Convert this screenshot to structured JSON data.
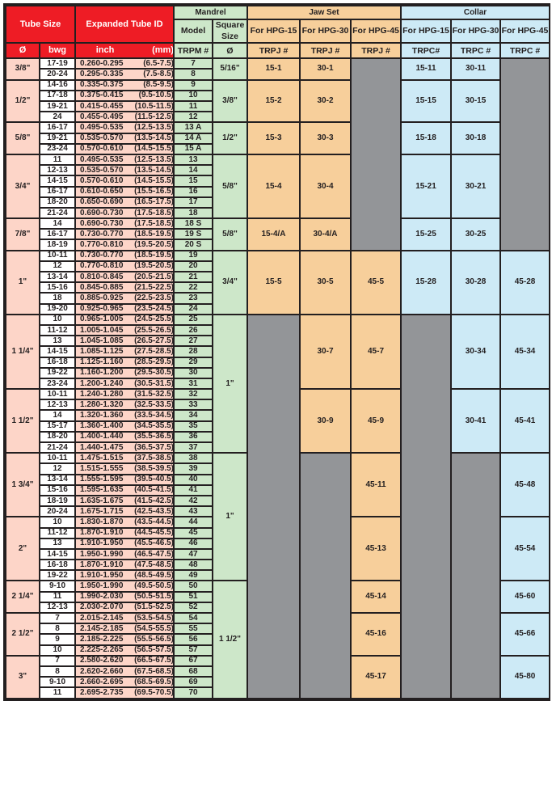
{
  "header": {
    "tube_size": "Tube Size",
    "expanded_id": "Expanded Tube ID",
    "mandrel": "Mandrel",
    "jaw_set": "Jaw Set",
    "collar": "Collar",
    "model": "Model",
    "square_size": "Square Size",
    "hpg15": "For HPG-15",
    "hpg30": "For HPG-30",
    "hpg45": "For HPG-45",
    "dia": "Ø",
    "bwg": "bwg",
    "inch": "inch",
    "mm": "(mm)",
    "trpm": "TRPM #",
    "sq_dia": "Ø",
    "trpj": "TRPJ #",
    "trpc1": "TRPC#",
    "trpc": "TRPC #"
  },
  "colors": {
    "red": "#ee1c25",
    "pink": "#fdd5c8",
    "green": "#cde7c9",
    "orange": "#f7cf9b",
    "blue": "#cdeaf6",
    "gray": "#939598"
  },
  "table": {
    "square_sizes": [
      {
        "size": "5/16\"",
        "rows": 2
      },
      {
        "size": "3/8\"",
        "rows": 4
      },
      {
        "size": "1/2\"",
        "rows": 3
      },
      {
        "size": "5/8\"",
        "rows": 6
      },
      {
        "size": "5/8\"",
        "rows": 3
      },
      {
        "size": "3/4\"",
        "rows": 6
      },
      {
        "size": "1\"",
        "rows": 13
      },
      {
        "size": "1\"",
        "rows": 12
      },
      {
        "size": "1 1/2\"",
        "rows": 11
      }
    ],
    "groups": [
      {
        "size": "3/8\"",
        "rows": [
          [
            "17-19",
            "0.260-0.295",
            "(6.5-7.5)",
            "7"
          ],
          [
            "20-24",
            "0.295-0.335",
            "(7.5-8.5)",
            "8"
          ]
        ],
        "jaw_hpg15": "15-1",
        "jaw_hpg30": "30-1",
        "jaw_hpg45": null,
        "collar_hpg15": "15-11",
        "collar_hpg30": "30-11",
        "collar_hpg45": null
      },
      {
        "size": "1/2\"",
        "rows": [
          [
            "14-16",
            "0.335-0.375",
            "(8.5-9.5)",
            "9"
          ],
          [
            "17-18",
            "0.375-0.415",
            "(9.5-10.5)",
            "10"
          ],
          [
            "19-21",
            "0.415-0.455",
            "(10.5-11.5)",
            "11"
          ],
          [
            "24",
            "0.455-0.495",
            "(11.5-12.5)",
            "12"
          ]
        ],
        "jaw_hpg15": "15-2",
        "jaw_hpg30": "30-2",
        "jaw_hpg45": null,
        "collar_hpg15": "15-15",
        "collar_hpg30": "30-15",
        "collar_hpg45": null
      },
      {
        "size": "5/8\"",
        "rows": [
          [
            "16-17",
            "0.495-0.535",
            "(12.5-13.5)",
            "13 A"
          ],
          [
            "19-21",
            "0.535-0.570",
            "(13.5-14.5)",
            "14 A"
          ],
          [
            "23-24",
            "0.570-0.610",
            "(14.5-15.5)",
            "15 A"
          ]
        ],
        "jaw_hpg15": "15-3",
        "jaw_hpg30": "30-3",
        "jaw_hpg45": null,
        "collar_hpg15": "15-18",
        "collar_hpg30": "30-18",
        "collar_hpg45": null
      },
      {
        "size": "3/4\"",
        "rows": [
          [
            "11",
            "0.495-0.535",
            "(12.5-13.5)",
            "13"
          ],
          [
            "12-13",
            "0.535-0.570",
            "(13.5-14.5)",
            "14"
          ],
          [
            "14-15",
            "0.570-0.610",
            "(14.5-15.5)",
            "15"
          ],
          [
            "16-17",
            "0.610-0.650",
            "(15.5-16.5)",
            "16"
          ],
          [
            "18-20",
            "0.650-0.690",
            "(16.5-17.5)",
            "17"
          ],
          [
            "21-24",
            "0.690-0.730",
            "(17.5-18.5)",
            "18"
          ]
        ],
        "jaw_hpg15": "15-4",
        "jaw_hpg30": "30-4",
        "jaw_hpg45": null,
        "collar_hpg15": "15-21",
        "collar_hpg30": "30-21",
        "collar_hpg45": null
      },
      {
        "size": "7/8\"",
        "rows": [
          [
            "14",
            "0.690-0.730",
            "(17.5-18.5)",
            "18 S"
          ],
          [
            "16-17",
            "0.730-0.770",
            "(18.5-19.5)",
            "19 S"
          ],
          [
            "18-19",
            "0.770-0.810",
            "(19.5-20.5)",
            "20 S"
          ]
        ],
        "jaw_hpg15": "15-4/A",
        "jaw_hpg30": "30-4/A",
        "jaw_hpg45": null,
        "collar_hpg15": "15-25",
        "collar_hpg30": "30-25",
        "collar_hpg45": null
      },
      {
        "size": "1\"",
        "rows": [
          [
            "10-11",
            "0.730-0.770",
            "(18.5-19.5)",
            "19"
          ],
          [
            "12",
            "0.770-0.810",
            "(19.5-20.5)",
            "20"
          ],
          [
            "13-14",
            "0.810-0.845",
            "(20.5-21.5)",
            "21"
          ],
          [
            "15-16",
            "0.845-0.885",
            "(21.5-22.5)",
            "22"
          ],
          [
            "18",
            "0.885-0.925",
            "(22.5-23.5)",
            "23"
          ],
          [
            "19-20",
            "0.925-0.965",
            "(23.5-24.5)",
            "24"
          ]
        ],
        "jaw_hpg15": "15-5",
        "jaw_hpg30": "30-5",
        "jaw_hpg45": "45-5",
        "collar_hpg15": "15-28",
        "collar_hpg30": "30-28",
        "collar_hpg45": "45-28"
      },
      {
        "size": "1 1/4\"",
        "rows": [
          [
            "10",
            "0.965-1.005",
            "(24.5-25.5)",
            "25"
          ],
          [
            "11-12",
            "1.005-1.045",
            "(25.5-26.5)",
            "26"
          ],
          [
            "13",
            "1.045-1.085",
            "(26.5-27.5)",
            "27"
          ],
          [
            "14-15",
            "1.085-1.125",
            "(27.5-28.5)",
            "28"
          ],
          [
            "16-18",
            "1.125-1.160",
            "(28.5-29.5)",
            "29"
          ],
          [
            "19-22",
            "1.160-1.200",
            "(29.5-30.5)",
            "30"
          ],
          [
            "23-24",
            "1.200-1.240",
            "(30.5-31.5)",
            "31"
          ]
        ],
        "jaw_hpg15": null,
        "jaw_hpg30": "30-7",
        "jaw_hpg45": "45-7",
        "collar_hpg15": null,
        "collar_hpg30": "30-34",
        "collar_hpg45": "45-34"
      },
      {
        "size": "1 1/2\"",
        "rows": [
          [
            "10-11",
            "1.240-1.280",
            "(31.5-32.5)",
            "32"
          ],
          [
            "12-13",
            "1.280-1.320",
            "(32.5-33.5)",
            "33"
          ],
          [
            "14",
            "1.320-1.360",
            "(33.5-34.5)",
            "34"
          ],
          [
            "15-17",
            "1.360-1.400",
            "(34.5-35.5)",
            "35"
          ],
          [
            "18-20",
            "1.400-1.440",
            "(35.5-36.5)",
            "36"
          ],
          [
            "21-24",
            "1.440-1.475",
            "(36.5-37.5)",
            "37"
          ]
        ],
        "jaw_hpg15": null,
        "jaw_hpg30": "30-9",
        "jaw_hpg45": "45-9",
        "collar_hpg15": null,
        "collar_hpg30": "30-41",
        "collar_hpg45": "45-41"
      },
      {
        "size": "1 3/4\"",
        "rows": [
          [
            "10-11",
            "1.475-1.515",
            "(37.5-38.5)",
            "38"
          ],
          [
            "12",
            "1.515-1.555",
            "(38.5-39.5)",
            "39"
          ],
          [
            "13-14",
            "1.555-1.595",
            "(39.5-40.5)",
            "40"
          ],
          [
            "15-16",
            "1.595-1.635",
            "(40.5-41.5)",
            "41"
          ],
          [
            "18-19",
            "1.635-1.675",
            "(41.5-42.5)",
            "42"
          ],
          [
            "20-24",
            "1.675-1.715",
            "(42.5-43.5)",
            "43"
          ]
        ],
        "jaw_hpg15": null,
        "jaw_hpg30": null,
        "jaw_hpg45": "45-11",
        "collar_hpg15": null,
        "collar_hpg30": null,
        "collar_hpg45": "45-48"
      },
      {
        "size": "2\"",
        "rows": [
          [
            "10",
            "1.830-1.870",
            "(43.5-44.5)",
            "44"
          ],
          [
            "11-12",
            "1.870-1.910",
            "(44.5-45.5)",
            "45"
          ],
          [
            "13",
            "1.910-1.950",
            "(45.5-46.5)",
            "46"
          ],
          [
            "14-15",
            "1.950-1.990",
            "(46.5-47.5)",
            "47"
          ],
          [
            "16-18",
            "1.870-1.910",
            "(47.5-48.5)",
            "48"
          ],
          [
            "19-22",
            "1.910-1.950",
            "(48.5-49.5)",
            "49"
          ]
        ],
        "jaw_hpg15": null,
        "jaw_hpg30": null,
        "jaw_hpg45": "45-13",
        "collar_hpg15": null,
        "collar_hpg30": null,
        "collar_hpg45": "45-54"
      },
      {
        "size": "2 1/4\"",
        "rows": [
          [
            "9-10",
            "1.950-1.990",
            "(49.5-50.5)",
            "50"
          ],
          [
            "11",
            "1.990-2.030",
            "(50.5-51.5)",
            "51"
          ],
          [
            "12-13",
            "2.030-2.070",
            "(51.5-52.5)",
            "52"
          ]
        ],
        "jaw_hpg15": null,
        "jaw_hpg30": null,
        "jaw_hpg45": "45-14",
        "collar_hpg15": null,
        "collar_hpg30": null,
        "collar_hpg45": "45-60"
      },
      {
        "size": "2 1/2\"",
        "rows": [
          [
            "7",
            "2.015-2.145",
            "(53.5-54.5)",
            "54"
          ],
          [
            "8",
            "2.145-2.185",
            "(54.5-55.5)",
            "55"
          ],
          [
            "9",
            "2.185-2.225",
            "(55.5-56.5)",
            "56"
          ],
          [
            "10",
            "2.225-2.265",
            "(56.5-57.5)",
            "57"
          ]
        ],
        "jaw_hpg15": null,
        "jaw_hpg30": null,
        "jaw_hpg45": "45-16",
        "collar_hpg15": null,
        "collar_hpg30": null,
        "collar_hpg45": "45-66"
      },
      {
        "size": "3\"",
        "rows": [
          [
            "7",
            "2.580-2.620",
            "(66.5-67.5)",
            "67"
          ],
          [
            "8",
            "2.620-2.660",
            "(67.5-68.5)",
            "68"
          ],
          [
            "9-10",
            "2.660-2.695",
            "(68.5-69.5)",
            "69"
          ],
          [
            "11",
            "2.695-2.735",
            "(69.5-70.5)",
            "70"
          ]
        ],
        "jaw_hpg15": null,
        "jaw_hpg30": null,
        "jaw_hpg45": "45-17",
        "collar_hpg15": null,
        "collar_hpg30": null,
        "collar_hpg45": "45-80"
      }
    ]
  }
}
